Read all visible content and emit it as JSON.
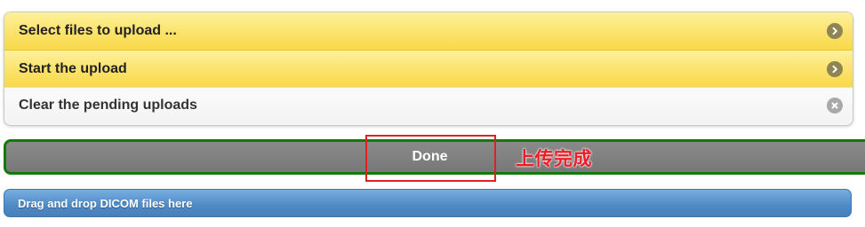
{
  "upload_actions": [
    {
      "label": "Select files to upload ...",
      "icon": "arrow-right-icon",
      "style": "yellow"
    },
    {
      "label": "Start the upload",
      "icon": "arrow-right-icon",
      "style": "yellow"
    },
    {
      "label": "Clear the pending uploads",
      "icon": "close-icon",
      "style": "plain"
    }
  ],
  "progress": {
    "text": "Done",
    "percent": 100,
    "border_color": "#117a0d",
    "fill_color": "#7d7d7d"
  },
  "annotation": {
    "text": "上传完成",
    "color": "#ee1c25"
  },
  "dropzone": {
    "label": "Drag and drop DICOM files here"
  }
}
